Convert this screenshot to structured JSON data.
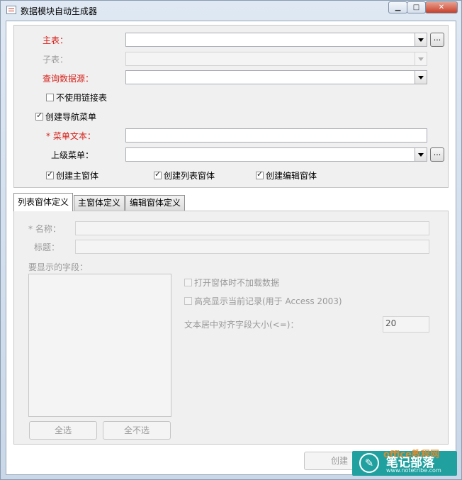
{
  "window": {
    "title": "数据模块自动生成器",
    "min": "▁",
    "max": "□",
    "close": "✕"
  },
  "form": {
    "main_table_label": "主表：",
    "sub_table_label": "子表：",
    "query_source_label": "查询数据源：",
    "no_linked_table_label": "不使用链接表",
    "create_nav_menu_label": "创建导航菜单",
    "menu_text_label": "* 菜单文本：",
    "parent_menu_label": "上级菜单：",
    "create_main_form_label": "创建主窗体",
    "create_list_form_label": "创建列表窗体",
    "create_edit_form_label": "创建编辑窗体",
    "dots": "..."
  },
  "tabs": [
    "列表窗体定义",
    "主窗体定义",
    "编辑窗体定义"
  ],
  "panel": {
    "name_label": "* 名称：",
    "caption_label": "标题：",
    "fields_label": "要显示的字段：",
    "no_load_label": "打开窗体时不加载数据",
    "highlight_label": "高亮显示当前记录(用于 Access 2003)",
    "center_align_label": "文本居中对齐字段大小(<=)：",
    "center_align_value": "20",
    "select_all": "全选",
    "select_none": "全不选"
  },
  "footer": {
    "create_button": "创建"
  },
  "watermark": {
    "text": "笔记部落",
    "url": "www.notetribe.com",
    "overlay": "office教程网"
  }
}
